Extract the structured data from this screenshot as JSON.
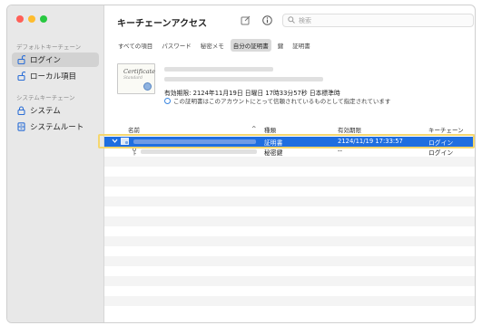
{
  "app": {
    "title": "キーチェーンアクセス"
  },
  "search": {
    "placeholder": "検索"
  },
  "sidebar": {
    "default_section": "デフォルトキーチェーン",
    "system_section": "システムキーチェーン",
    "items": [
      {
        "label": "ログイン",
        "icon": "unlocked-padlock-icon",
        "selected": true
      },
      {
        "label": "ローカル項目",
        "icon": "unlocked-padlock-icon",
        "selected": false
      },
      {
        "label": "システム",
        "icon": "padlock-icon",
        "selected": false
      },
      {
        "label": "システムルート",
        "icon": "cabinet-icon",
        "selected": false
      }
    ]
  },
  "tabs": [
    {
      "label": "すべての項目",
      "active": false
    },
    {
      "label": "パスワード",
      "active": false
    },
    {
      "label": "秘密メモ",
      "active": false
    },
    {
      "label": "自分の証明書",
      "active": true
    },
    {
      "label": "鍵",
      "active": false
    },
    {
      "label": "証明書",
      "active": false
    }
  ],
  "details": {
    "cert_image_text": "Certificate",
    "cert_image_subtext": "Standard",
    "expiry": "有効期限: 2124年11月19日 日曜日 17時33分57秒 日本標準時",
    "trust": "この証明書はこのアカウントにとって信頼されているものとして指定されています"
  },
  "table": {
    "headers": {
      "name": "名前",
      "kind": "種類",
      "expires": "有効期限",
      "keychain": "キーチェーン"
    },
    "sort_indicator": "^",
    "rows": [
      {
        "kind": "証明書",
        "expires": "2124/11/19 17:33:57",
        "keychain": "ログイン",
        "selected": true
      },
      {
        "kind": "秘密鍵",
        "expires": "--",
        "keychain": "ログイン",
        "selected": false
      }
    ]
  },
  "colors": {
    "accent": "#1f6ee0",
    "highlight": "#f5d76e"
  }
}
